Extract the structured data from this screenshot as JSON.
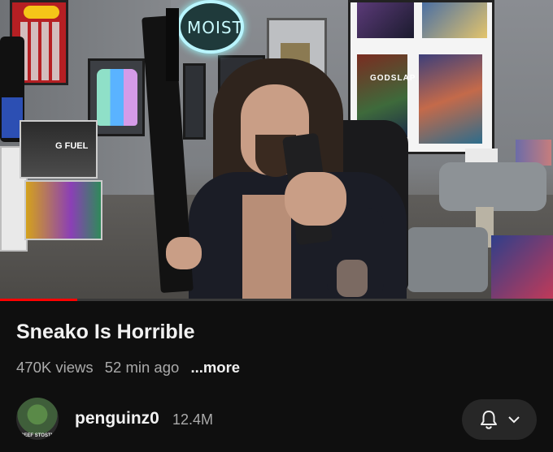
{
  "video": {
    "progress_fraction": 0.14,
    "colors": {
      "progress": "#ff0000",
      "track": "#3a3a3a"
    },
    "scene_text": {
      "neon_sign": "MOIST",
      "gfuel_box": "G FUEL",
      "poster": "GODSLAP"
    }
  },
  "info": {
    "title": "Sneako Is Horrible",
    "views": "470K views",
    "age": "52 min ago",
    "more": "...more"
  },
  "channel": {
    "name": "penguinz0",
    "subscribers": "12.4M",
    "avatar_caption": "BEEF STOSTH",
    "bell_icon": "bell-icon",
    "dropdown_icon": "chevron-down-icon"
  }
}
